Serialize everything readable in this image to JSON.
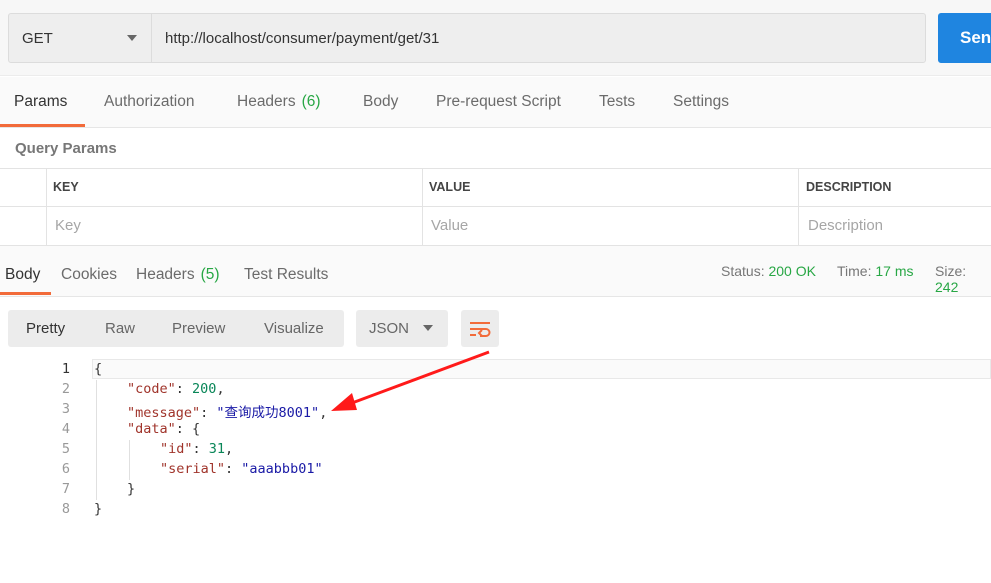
{
  "request": {
    "method": "GET",
    "url": "http://localhost/consumer/payment/get/31",
    "send_label": "Send"
  },
  "request_tabs": [
    {
      "label": "Params",
      "count": ""
    },
    {
      "label": "Authorization",
      "count": ""
    },
    {
      "label": "Headers",
      "count": "(6)"
    },
    {
      "label": "Body",
      "count": ""
    },
    {
      "label": "Pre-request Script",
      "count": ""
    },
    {
      "label": "Tests",
      "count": ""
    },
    {
      "label": "Settings",
      "count": ""
    }
  ],
  "query_params": {
    "title": "Query Params",
    "headers": [
      "KEY",
      "VALUE",
      "DESCRIPTION"
    ],
    "placeholders": [
      "Key",
      "Value",
      "Description"
    ]
  },
  "response_tabs": [
    {
      "label": "Body",
      "count": ""
    },
    {
      "label": "Cookies",
      "count": ""
    },
    {
      "label": "Headers",
      "count": "(5)"
    },
    {
      "label": "Test Results",
      "count": ""
    }
  ],
  "response_status": {
    "status_label": "Status:",
    "status_value": "200 OK",
    "time_label": "Time:",
    "time_value": "17 ms",
    "size_label": "Size:",
    "size_value": "242"
  },
  "view_modes": [
    "Pretty",
    "Raw",
    "Preview",
    "Visualize"
  ],
  "format": "JSON",
  "icons": {
    "wrap": "wrap-lines-icon",
    "dropdown": "chevron-down-icon",
    "annotation": "red-arrow-icon"
  },
  "colors": {
    "accent": "#f26b3a",
    "send": "#1f85e0",
    "success": "#28a745",
    "annotation": "#ff1a1a"
  },
  "code": {
    "line_numbers": [
      "1",
      "2",
      "3",
      "4",
      "5",
      "6",
      "7",
      "8"
    ],
    "open_brace": "{",
    "close_brace": "}",
    "code_key": "\"code\"",
    "code_value": "200",
    "message_key": "\"message\"",
    "message_value": "\"查询成功8001\"",
    "data_key": "\"data\"",
    "id_key": "\"id\"",
    "id_value": "31",
    "serial_key": "\"serial\"",
    "serial_value": "\"aaabbb01\"",
    "colon": ": ",
    "comma": ","
  }
}
